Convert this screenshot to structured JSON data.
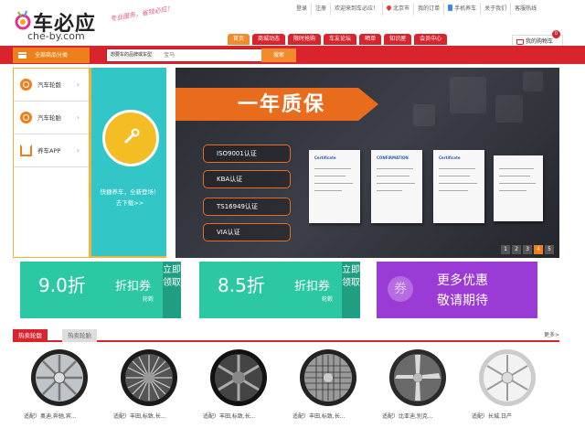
{
  "topbar": {
    "login": "登录",
    "register": "注册",
    "welcome": "欢迎来到车必应！",
    "city": "北京市",
    "my_orders": "我的订单",
    "mobile": "手机养车",
    "about": "关于我们",
    "hotline": "客服热线"
  },
  "logo": {
    "name": "车必应",
    "domain": "che-by.com",
    "slogan": "专业服务，省钱必应！"
  },
  "nav": {
    "tabs": [
      "首页",
      "商城动态",
      "限时抢购",
      "车友论坛",
      "晒单",
      "知识屋",
      "会员中心"
    ]
  },
  "cart": {
    "label": "我的购物车",
    "count": "0"
  },
  "category": {
    "label": "全部商品分类"
  },
  "search": {
    "prefix": "想要车的品牌或车型",
    "placeholder": "宝马",
    "button": "搜索"
  },
  "sidebar": {
    "items": [
      {
        "label": "汽车轮毂",
        "icon": "wheel-icon"
      },
      {
        "label": "汽车轮胎",
        "icon": "tire-icon"
      },
      {
        "label": "养车APP",
        "icon": "house-icon"
      }
    ]
  },
  "promo": {
    "line1": "快捷养车，全新登场！",
    "line2": "去下载>>"
  },
  "banner": {
    "title": "一年质保",
    "certs": [
      "ISO9001认证",
      "KBA认证",
      "TS16949认证",
      "VIA认证"
    ],
    "doc_titles": [
      "Certificate",
      "CONFIRMATION",
      "Certificate",
      ""
    ],
    "slides": [
      "1",
      "2",
      "3",
      "4",
      "5"
    ],
    "active_slide": 4
  },
  "coupons": [
    {
      "discount": "9.0折",
      "label": "折扣券",
      "sub": "轮毂",
      "action": "立即领取",
      "color": "#2cc7a3",
      "side_color": "#1f9e82"
    },
    {
      "discount": "8.5折",
      "label": "折扣券",
      "sub": "轮毂",
      "action": "立即领取",
      "color": "#2cc7a3",
      "side_color": "#1f9e82"
    },
    {
      "icon_char": "券",
      "line1": "更多优惠",
      "line2": "敬请期待",
      "color": "#9b3bd6"
    }
  ],
  "hot": {
    "tab_active": "热卖轮毂",
    "tab_other": "热卖轮胎",
    "more": "更多>"
  },
  "products": [
    {
      "caption": "适配）奥迪,奔驰,宾..."
    },
    {
      "caption": "适配）丰田,标致,长..."
    },
    {
      "caption": "适配）丰田,标致,长..."
    },
    {
      "caption": "适配）丰田,标致,长..."
    },
    {
      "caption": "适配）比亚迪,别克..."
    },
    {
      "caption": "适配）长城,日产"
    }
  ]
}
